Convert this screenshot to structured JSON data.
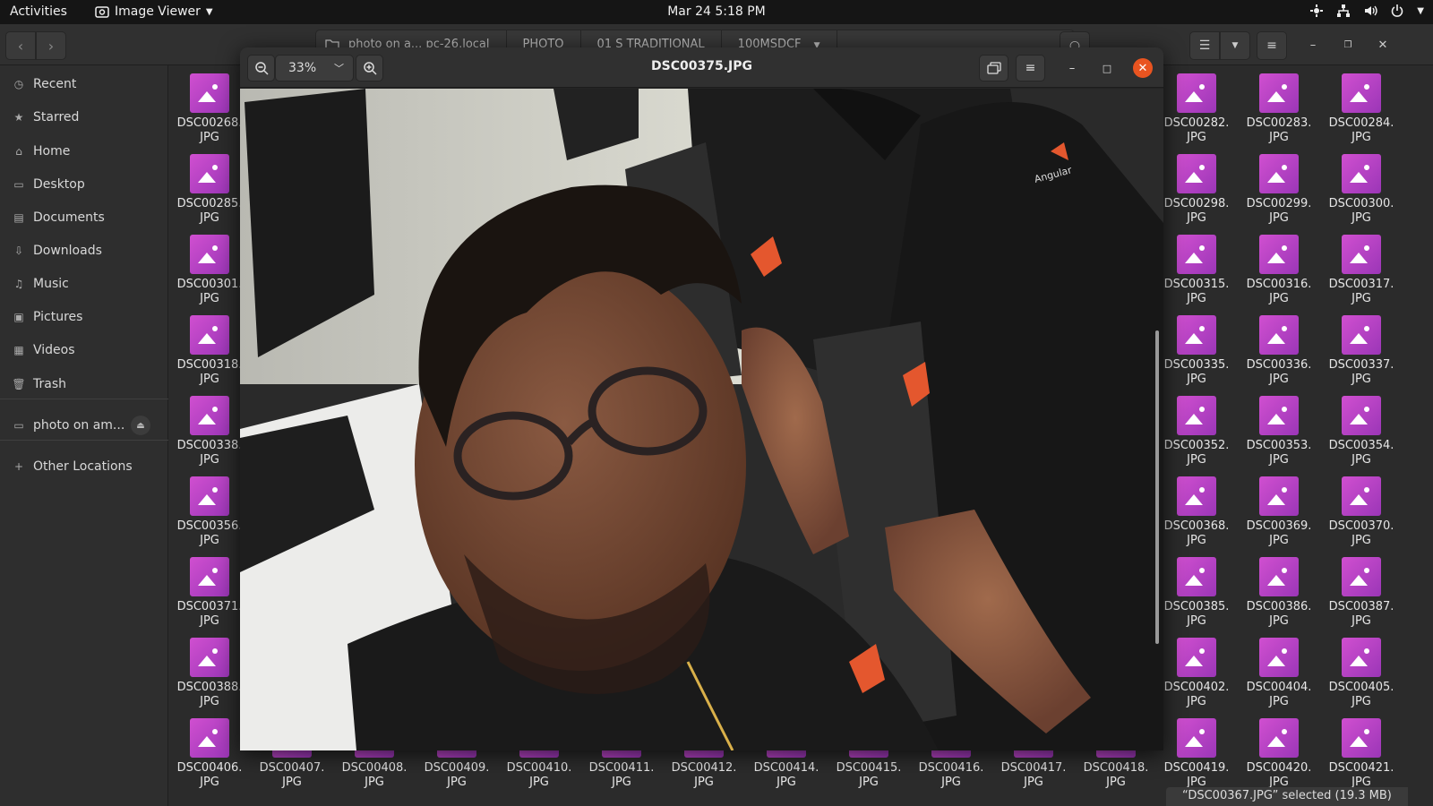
{
  "topbar": {
    "activities": "Activities",
    "app_name": "Image Viewer",
    "clock": "Mar 24  5:18 PM"
  },
  "files": {
    "path": [
      "photo on a... pc-26.local",
      "PHOTO",
      "01 S TRADITIONAL",
      "100MSDCF"
    ],
    "sidebar": [
      {
        "label": "Recent",
        "icon": "clock-icon"
      },
      {
        "label": "Starred",
        "icon": "star-icon"
      },
      {
        "label": "Home",
        "icon": "home-icon"
      },
      {
        "label": "Desktop",
        "icon": "desktop-icon"
      },
      {
        "label": "Documents",
        "icon": "document-icon"
      },
      {
        "label": "Downloads",
        "icon": "download-icon"
      },
      {
        "label": "Music",
        "icon": "music-icon"
      },
      {
        "label": "Pictures",
        "icon": "pictures-icon"
      },
      {
        "label": "Videos",
        "icon": "video-icon"
      },
      {
        "label": "Trash",
        "icon": "trash-icon"
      }
    ],
    "mount": "photo on am...",
    "other_locations": "Other Locations",
    "left_column": [
      "DSC00268.",
      "DSC00285.",
      "DSC00301.",
      "DSC00318.",
      "DSC00338.",
      "DSC00356.",
      "DSC00371.",
      "DSC00388."
    ],
    "right_grid": [
      [
        "DSC00282.",
        "DSC00283.",
        "DSC00284."
      ],
      [
        "DSC00298.",
        "DSC00299.",
        "DSC00300."
      ],
      [
        "DSC00315.",
        "DSC00316.",
        "DSC00317."
      ],
      [
        "DSC00335.",
        "DSC00336.",
        "DSC00337."
      ],
      [
        "DSC00352.",
        "DSC00353.",
        "DSC00354."
      ],
      [
        "DSC00368.",
        "DSC00369.",
        "DSC00370."
      ],
      [
        "DSC00385.",
        "DSC00386.",
        "DSC00387."
      ],
      [
        "DSC00402.",
        "DSC00404.",
        "DSC00405."
      ]
    ],
    "bottom_row": [
      "DSC00406.",
      "DSC00407.",
      "DSC00408.",
      "DSC00409.",
      "DSC00410.",
      "DSC00411.",
      "DSC00412.",
      "DSC00414.",
      "DSC00415.",
      "DSC00416.",
      "DSC00417.",
      "DSC00418.",
      "DSC00419.",
      "DSC00420.",
      "DSC00421."
    ],
    "ext": "JPG",
    "status": "“DSC00367.JPG” selected  (19.3 MB)"
  },
  "viewer": {
    "zoom": "33%",
    "title": "DSC00375.JPG",
    "logo_text": "Angular"
  }
}
